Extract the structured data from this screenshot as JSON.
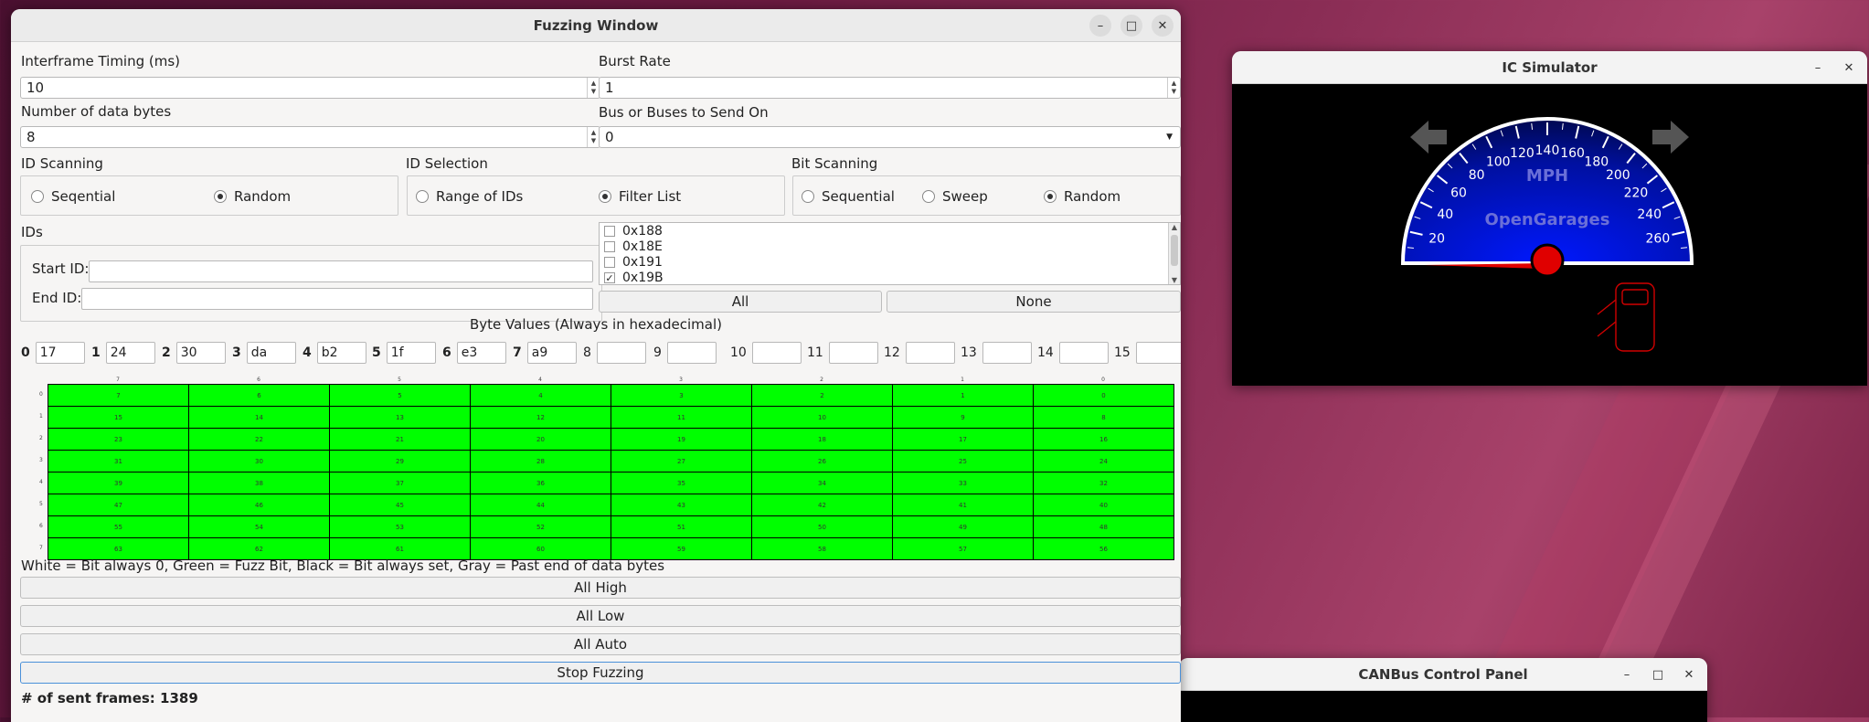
{
  "fuzz": {
    "title": "Fuzzing Window",
    "interframe_label": "Interframe Timing (ms)",
    "interframe_value": "10",
    "burst_label": "Burst Rate",
    "burst_value": "1",
    "num_bytes_label": "Number of data bytes",
    "num_bytes_value": "8",
    "bus_label": "Bus or Buses to Send On",
    "bus_value": "0",
    "id_scanning": {
      "label": "ID Scanning",
      "opt1": "Seqential",
      "opt2": "Random",
      "selected": "Random"
    },
    "id_selection": {
      "label": "ID Selection",
      "opt1": "Range of IDs",
      "opt2": "Filter List",
      "selected": "Filter List"
    },
    "bit_scanning": {
      "label": "Bit Scanning",
      "opt1": "Sequential",
      "opt2": "Sweep",
      "opt3": "Random",
      "selected": "Random"
    },
    "ids_label": "IDs",
    "start_id_label": "Start ID:",
    "end_id_label": "End ID:",
    "filter_list": [
      {
        "label": "0x188",
        "checked": false
      },
      {
        "label": "0x18E",
        "checked": false
      },
      {
        "label": "0x191",
        "checked": false
      },
      {
        "label": "0x19B",
        "checked": true
      }
    ],
    "all_button": "All",
    "none_button": "None",
    "byte_values_label": "Byte Values (Always in hexadecimal)",
    "bytes": [
      {
        "i": "0",
        "v": "17"
      },
      {
        "i": "1",
        "v": "24"
      },
      {
        "i": "2",
        "v": "30"
      },
      {
        "i": "3",
        "v": "da"
      },
      {
        "i": "4",
        "v": "b2"
      },
      {
        "i": "5",
        "v": "1f"
      },
      {
        "i": "6",
        "v": "e3"
      },
      {
        "i": "7",
        "v": "a9"
      },
      {
        "i": "8",
        "v": ""
      },
      {
        "i": "9",
        "v": ""
      },
      {
        "i": "10",
        "v": ""
      },
      {
        "i": "11",
        "v": ""
      },
      {
        "i": "12",
        "v": ""
      },
      {
        "i": "13",
        "v": ""
      },
      {
        "i": "14",
        "v": ""
      },
      {
        "i": "15",
        "v": ""
      }
    ],
    "bit_grid": {
      "col_headers": [
        "7",
        "6",
        "5",
        "4",
        "3",
        "2",
        "1",
        "0"
      ],
      "row_headers": [
        "0",
        "1",
        "2",
        "3",
        "4",
        "5",
        "6",
        "7"
      ],
      "color": "#00ff00"
    },
    "legend": "White = Bit always 0, Green = Fuzz Bit, Black = Bit always set, Gray = Past end of data bytes",
    "all_high": "All High",
    "all_low": "All Low",
    "all_auto": "All Auto",
    "stop": "Stop Fuzzing",
    "sent_frames": "# of sent frames: 1389"
  },
  "ic": {
    "title": "IC Simulator",
    "unit": "MPH",
    "brand": "OpenGarages",
    "ticks": [
      "20",
      "40",
      "60",
      "80",
      "100",
      "120",
      "140",
      "160",
      "180",
      "200",
      "220",
      "240",
      "260"
    ]
  },
  "canbus": {
    "title": "CANBus Control Panel"
  },
  "icons": [
    "minimize-icon",
    "maximize-icon",
    "close-icon",
    "left-arrow-icon",
    "right-arrow-icon",
    "door-icon",
    "dropdown-icon",
    "checkbox-icon"
  ]
}
